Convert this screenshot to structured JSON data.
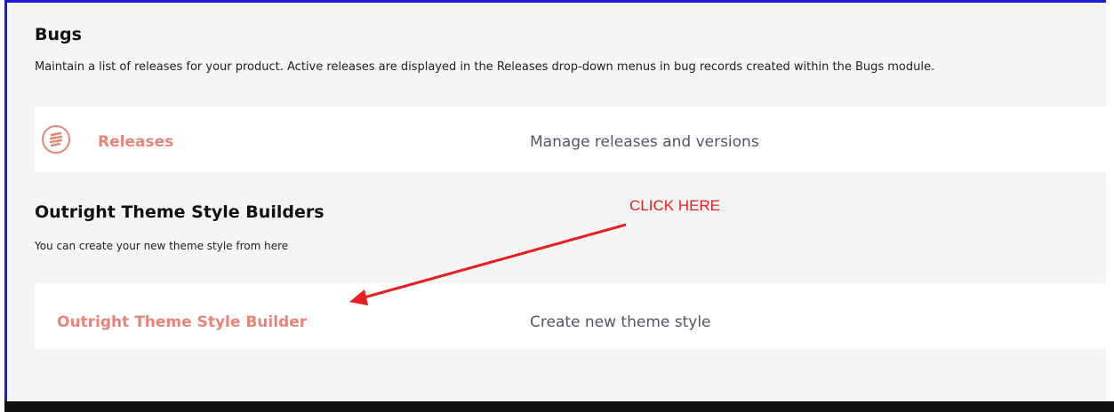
{
  "bugs": {
    "title": "Bugs",
    "description": "Maintain a list of releases for your product. Active releases are displayed in the Releases drop-down menus in bug records created within the Bugs module.",
    "releases": {
      "label": "Releases",
      "description": "Manage releases and versions",
      "icon": "releases-icon"
    }
  },
  "outright": {
    "title": "Outright Theme Style Builders",
    "description": "You can create your new theme style from here",
    "builder": {
      "label": "Outright Theme Style Builder",
      "description": "Create new theme style"
    }
  },
  "annotation": {
    "text": "CLICK HERE",
    "color": "#e81e1e"
  },
  "colors": {
    "link": "#e8857a",
    "frame_border": "#1a1ad6"
  }
}
